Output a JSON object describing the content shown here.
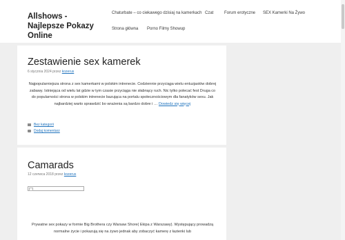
{
  "site": {
    "title": "Allshows - Najlepsze Pokazy Online"
  },
  "nav": {
    "items": [
      "Chaturbate – co ciekawego dzisiaj na kamerkach",
      "Czat",
      "Forum erotyczne",
      "SEX Kamerki Na Żywo",
      "Strona główna",
      "Porno Filmy Showup"
    ]
  },
  "articles": [
    {
      "title": "Zestawienie sex kamerek",
      "date": "6 stycznia 2024",
      "by": "przez",
      "author": "kozerus",
      "excerpt": "Najpopularniejsza strona z sex kamerkami w polskim intrenecie. Codziennie przyciąga wielu entuzjastów dobrej zabawy. Istniejąca od wielu lat gdzie w tym czasie przyciąga nie słabnący ruch. Nic tylko polecać fest Druga co do popularności strona w polskim intrenecie bazująca na portalu społecznościowym dla fanatyków sexu. Jak najbardziej warto sprawdzić bo wrażenia są bardzo dobre i …",
      "read_more": "Dowiedz się więcej",
      "category": "Bez kategorii",
      "comment": "Dodaj komentarz"
    },
    {
      "title": "Camarads",
      "date": "12 czerwca 2018",
      "by": "przez",
      "author": "kozerus",
      "excerpt": "Prywatne sex pokazy w formie Big Brothera czy Warsaw Shore( Ekipa z Warszawy). Występujący prowadzą normalne życie i pokazują się na żywo jednak aby zobaczyć kamerę z łazienki lub"
    }
  ],
  "colors": {
    "link": "#1e72bd",
    "background": "#efefef"
  }
}
